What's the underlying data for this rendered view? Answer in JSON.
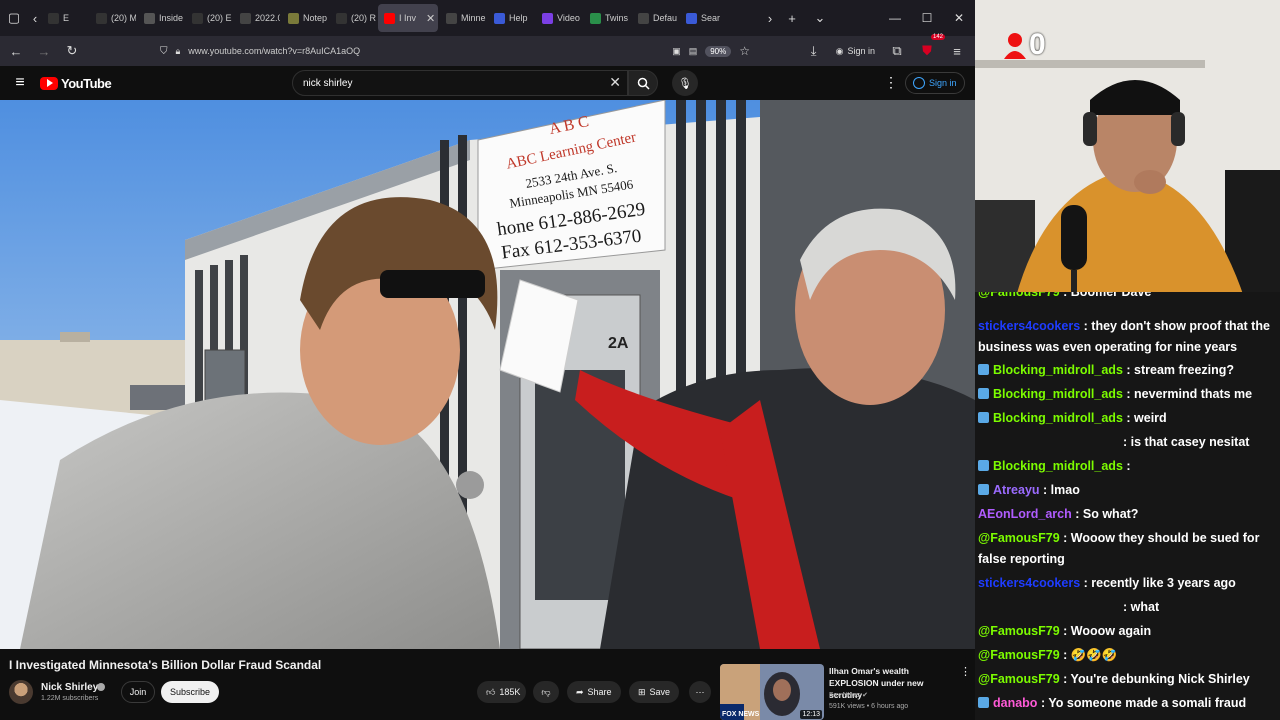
{
  "browser": {
    "tabs": [
      {
        "label": "E",
        "favicon": "x-icon",
        "color": "#333333"
      },
      {
        "label": "(20) M",
        "favicon": "x-icon",
        "color": "#333333"
      },
      {
        "label": "Inside",
        "favicon": "generic-icon",
        "color": "#555555"
      },
      {
        "label": "(20) E",
        "favicon": "x-icon",
        "color": "#333333"
      },
      {
        "label": "2022.0",
        "favicon": "generic-icon",
        "color": "#444444"
      },
      {
        "label": "Notep",
        "favicon": "note-icon",
        "color": "#7a7a3a"
      },
      {
        "label": "(20) R",
        "favicon": "x-icon",
        "color": "#333333"
      },
      {
        "label": "I Inv",
        "favicon": "youtube-icon",
        "color": "#ff0000"
      },
      {
        "label": "Minne",
        "favicon": "generic-icon",
        "color": "#444444"
      },
      {
        "label": "Help",
        "favicon": "m-icon",
        "color": "#3a5ad7"
      },
      {
        "label": "Video",
        "favicon": "v-icon",
        "color": "#7b3fe4"
      },
      {
        "label": "Twins",
        "favicon": "maps-icon",
        "color": "#2a8f4a"
      },
      {
        "label": "Defau",
        "favicon": "generic-icon",
        "color": "#444444"
      },
      {
        "label": "Sear",
        "favicon": "m-icon",
        "color": "#3a5ad7"
      }
    ],
    "url": "www.youtube.com/watch?v=r8AuICA1aOQ",
    "zoom": "90%",
    "sign_in": "Sign in",
    "extension_count": "142"
  },
  "youtube": {
    "logo_text": "YouTube",
    "search_value": "nick shirley",
    "sign_in": "Sign in",
    "video": {
      "sign_lines": [
        "ABC Learning Center",
        "2533 24th Ave. S.",
        "Minneapolis MN 55406",
        "hone 612-886-2629",
        "Fax 612-353-6370"
      ],
      "door_number": "2A"
    },
    "title": "I Investigated Minnesota's Billion Dollar Fraud Scandal",
    "channel": {
      "name": "Nick Shirley",
      "subscribers": "1.22M subscribers",
      "join": "Join",
      "subscribe": "Subscribe"
    },
    "actions": {
      "likes": "185K",
      "share": "Share",
      "save": "Save"
    },
    "recommended": {
      "title": "Ilhan Omar's wealth EXPLOSION under new scrutiny",
      "channel": "Fox News",
      "views": "591K views",
      "age": "6 hours ago",
      "duration": "12:13",
      "thumb_label": "FOX NEWS"
    }
  },
  "stream": {
    "counter": "0",
    "chat": [
      {
        "user": "@FamousF79",
        "text": ": Boomer Dave",
        "user_color": "#7CFC00",
        "badge": false
      },
      {
        "user": "stickers4cookers",
        "text": ": they don't show proof that the business was even operating for nine years",
        "user_color": "#1e3cff",
        "badge": false
      },
      {
        "user": "Blocking_midroll_ads",
        "text": ": stream freezing?",
        "user_color": "#7CFC00",
        "badge": true
      },
      {
        "user": "Blocking_midroll_ads",
        "text": ": nevermind thats me",
        "user_color": "#7CFC00",
        "badge": true
      },
      {
        "user": "Blocking_midroll_ads",
        "text": ": weird",
        "user_color": "#7CFC00",
        "badge": true
      },
      {
        "user": "",
        "text": ": is that casey nesitat",
        "user_color": "#7CFC00",
        "badge": false
      },
      {
        "user": "Blocking_midroll_ads",
        "text": ":",
        "user_color": "#7CFC00",
        "badge": true
      },
      {
        "user": "Atreayu",
        "text": ": lmao",
        "user_color": "#9b6bff",
        "badge": true
      },
      {
        "user": "AEonLord_arch",
        "text": ": So what?",
        "user_color": "#b05cff",
        "badge": false
      },
      {
        "user": "@FamousF79",
        "text": ": Wooow they should be sued for false reporting",
        "user_color": "#7CFC00",
        "badge": false
      },
      {
        "user": "stickers4cookers",
        "text": ": recently like 3 years ago",
        "user_color": "#1e3cff",
        "badge": false
      },
      {
        "user": "",
        "text": ": what",
        "user_color": "#7CFC00",
        "badge": false
      },
      {
        "user": "@FamousF79",
        "text": ": Wooow again",
        "user_color": "#7CFC00",
        "badge": false
      },
      {
        "user": "@FamousF79",
        "text": ": 🤣🤣🤣",
        "user_color": "#7CFC00",
        "badge": false
      },
      {
        "user": "@FamousF79",
        "text": ": You're debunking Nick Shirley",
        "user_color": "#7CFC00",
        "badge": false
      },
      {
        "user": "danabo",
        "text": ": Yo someone made a somali fraud",
        "user_color": "#ff5ad7",
        "badge": true
      }
    ]
  }
}
